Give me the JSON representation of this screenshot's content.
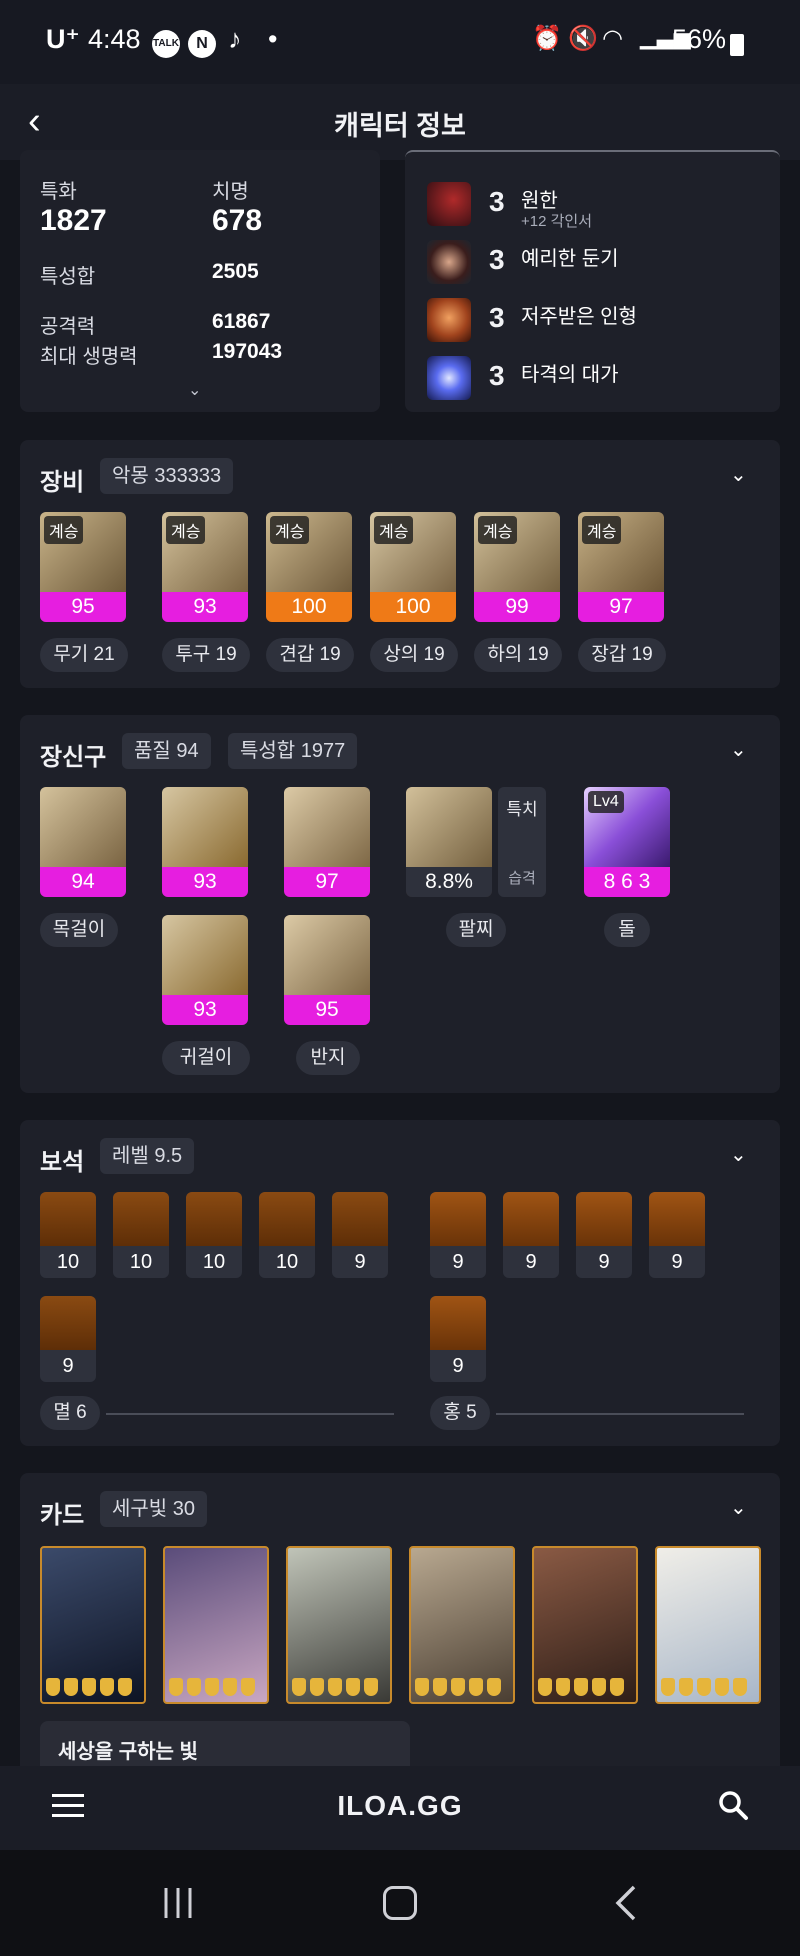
{
  "status": {
    "carrier": "U⁺",
    "time": "4:48",
    "talk_badge": "TALK",
    "n_badge": "N",
    "dot": "•",
    "battery": "56%"
  },
  "header": {
    "title": "캐릭터 정보"
  },
  "stats": {
    "items": [
      {
        "label": "특화",
        "value": "1827"
      },
      {
        "label": "치명",
        "value": "678"
      },
      {
        "label": "특성합",
        "value": "2505"
      },
      {
        "label": "공격력",
        "value": "61867"
      },
      {
        "label": "최대 생명력",
        "value": "197043"
      }
    ]
  },
  "engravings": [
    {
      "level": "3",
      "name": "원한",
      "sub": "+12 각인서"
    },
    {
      "level": "3",
      "name": "예리한 둔기"
    },
    {
      "level": "3",
      "name": "저주받은 인형"
    },
    {
      "level": "3",
      "name": "타격의 대가"
    }
  ],
  "equipment": {
    "title": "장비",
    "tag": "악몽 333333",
    "items": [
      {
        "badge": "계승",
        "quality": "95",
        "label": "무기 21",
        "color": "magenta"
      },
      {
        "badge": "계승",
        "quality": "93",
        "label": "투구 19",
        "color": "magenta"
      },
      {
        "badge": "계승",
        "quality": "100",
        "label": "견갑 19",
        "color": "orange"
      },
      {
        "badge": "계승",
        "quality": "100",
        "label": "상의 19",
        "color": "orange"
      },
      {
        "badge": "계승",
        "quality": "99",
        "label": "하의 19",
        "color": "magenta"
      },
      {
        "badge": "계승",
        "quality": "97",
        "label": "장갑 19",
        "color": "magenta"
      }
    ]
  },
  "accessories": {
    "title": "장신구",
    "tags": [
      "품질 94",
      "특성합 1977"
    ],
    "items": [
      {
        "quality": "94"
      },
      {
        "quality": "93"
      },
      {
        "quality": "97"
      },
      {
        "quality": "93"
      },
      {
        "quality": "95"
      }
    ],
    "labels": [
      "목걸이",
      "귀걸이",
      "반지",
      "팔찌",
      "돌"
    ],
    "bracelet": {
      "value": "8.8%",
      "stat1": "특치",
      "stat2": "습격"
    },
    "stone": {
      "badge": "Lv4",
      "value": "8 6 3"
    }
  },
  "gems": {
    "title": "보석",
    "tag": "레벨 9.5",
    "left": [
      "10",
      "10",
      "10",
      "10",
      "9",
      "9"
    ],
    "right": [
      "9",
      "9",
      "9",
      "9",
      "9"
    ],
    "left_label": "멸 6",
    "right_label": "홍 5"
  },
  "cards": {
    "title": "카드",
    "tag": "세구빛 30",
    "set_name": "세상을 구하는 빛"
  },
  "footer": {
    "logo": "ILOA.GG"
  },
  "colors": {
    "magenta": "#e61ee0",
    "orange": "#ef7a17",
    "background": "#14161d",
    "card": "#1e2029"
  }
}
